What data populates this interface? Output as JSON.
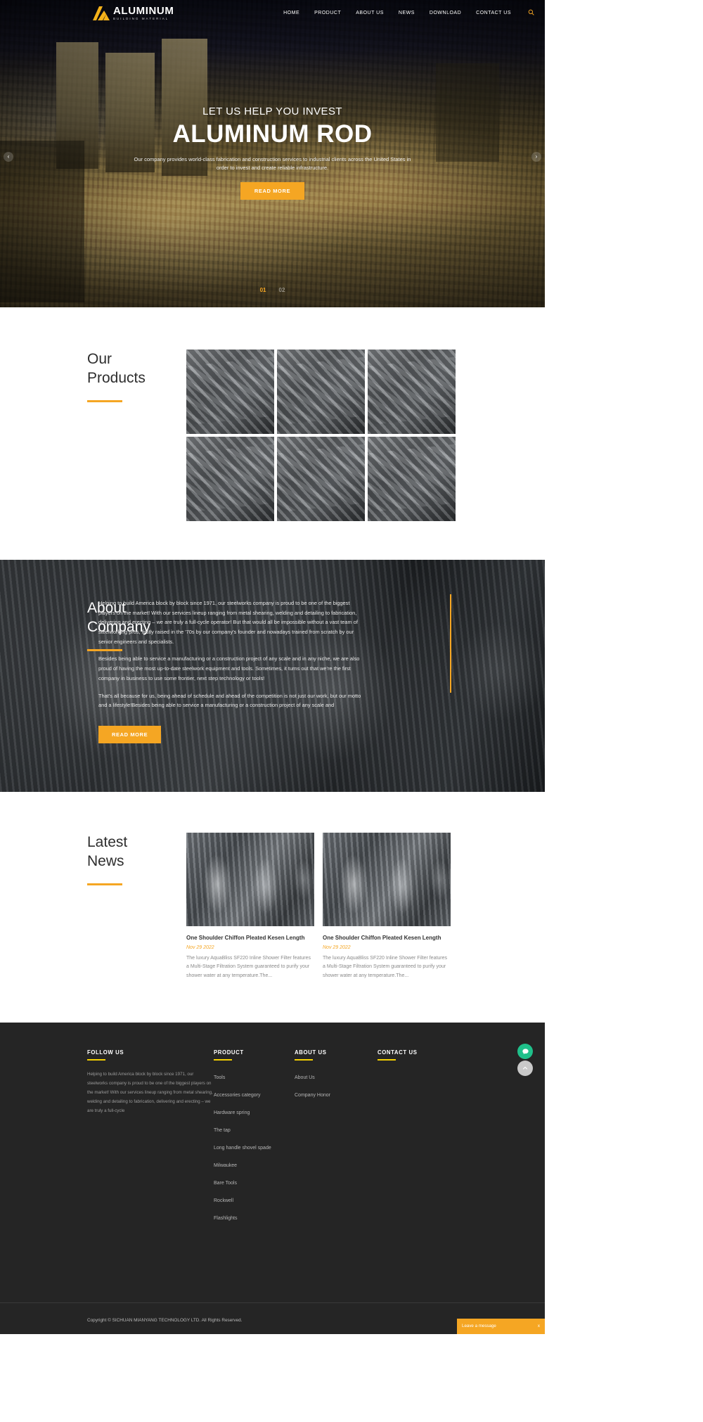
{
  "header": {
    "logo_text": "ALUMINUM",
    "logo_sub": "BUILDING MATERIAL",
    "nav": [
      {
        "label": "HOME"
      },
      {
        "label": "PRODUCT"
      },
      {
        "label": "ABOUT US"
      },
      {
        "label": "NEWS"
      },
      {
        "label": "DOWNLOAD"
      },
      {
        "label": "CONTACT US"
      }
    ],
    "search_icon": "search-icon"
  },
  "hero": {
    "kicker": "LET US HELP YOU INVEST",
    "title": "ALUMINUM ROD",
    "desc": "Our company provides world-class fabrication and construction services to industrial clients across the United States in order to invest and create reliable infrastructure.",
    "button": "READ MORE",
    "prev_icon": "chevron-left-icon",
    "next_icon": "chevron-right-icon",
    "slides": [
      {
        "label": "01",
        "active": true
      },
      {
        "label": "02",
        "active": false
      }
    ]
  },
  "products": {
    "title_line1": "Our",
    "title_line2": "Products",
    "items": [
      {
        "alt": "aluminum-profile-1"
      },
      {
        "alt": "aluminum-profile-2"
      },
      {
        "alt": "aluminum-profile-3"
      },
      {
        "alt": "aluminum-profile-4"
      },
      {
        "alt": "aluminum-profile-5"
      },
      {
        "alt": "aluminum-profile-6"
      }
    ]
  },
  "about": {
    "title_line1": "About",
    "title_line2": "Company",
    "p1": "Helping to build America block by block since 1971, our steelworks company is proud to be one of the biggest players on the market! With our services lineup ranging from metal shearing, welding and detailing to fabrication, delivering and erecting – we are truly a full-cycle operator! But that would all be impossible without a vast team of steelworking pros, firstly raised in the '70s by our company's founder and nowadays trained from scratch by our senior engineers and specialists.",
    "p2": "Besides being able to service a manufacturing or a construction project of any scale and in any niche, we are also proud of having the most up-to-date steelwork equipment and tools. Sometimes, it turns out that we're the first company in business to use some frontier, next step technology or tools!",
    "p3": "That's all because for us, being ahead of schedule and ahead of the competition is not just our work, but our motto and a lifestyle!Besides being able to service a manufacturing or a construction project of any scale and",
    "button": "READ MORE"
  },
  "news": {
    "title_line1": "Latest",
    "title_line2": "News",
    "cards": [
      {
        "title": "One Shoulder Chiffon Pleated Kesen Length",
        "date": "Nov 29 2022",
        "text": "The luxury AquaBliss SF220 Inline Shower Filter features a Multi-Stage Filtration System guaranteed to purify your shower water at any temperature.The..."
      },
      {
        "title": "One Shoulder Chiffon Pleated Kesen Length",
        "date": "Nov 29 2022",
        "text": "The luxury AquaBliss SF220 Inline Shower Filter features a Multi-Stage Filtration System guaranteed to purify your shower water at any temperature.The..."
      }
    ]
  },
  "footer": {
    "follow": {
      "title": "FOLLOW US",
      "text": "Helping to build America block by block since 1971, our steelworks company is proud to be one of the biggest players on the market! With our services lineup ranging from metal shearing, welding and detailing to fabrication, delivering and erecting – we are truly a full-cycle"
    },
    "product": {
      "title": "PRODUCT",
      "links": [
        {
          "label": "Tools"
        },
        {
          "label": "Accessories category"
        },
        {
          "label": "Hardware spring"
        },
        {
          "label": "The tap"
        },
        {
          "label": "Long handle shovel spade"
        },
        {
          "label": "Milwaukee"
        },
        {
          "label": "Bare Tools"
        },
        {
          "label": "Rockwell"
        },
        {
          "label": "Flashlights"
        }
      ]
    },
    "about": {
      "title": "ABOUT US",
      "links": [
        {
          "label": "About Us"
        },
        {
          "label": "Company Honor"
        }
      ]
    },
    "contact": {
      "title": "CONTACT US",
      "links": []
    },
    "copyright": "Copyright © SICHUAN MIANYANG TECHNOLOGY LTD. All Rights Reserved."
  },
  "widgets": {
    "chat_icon": "chat-bubble-icon",
    "scroll_top_icon": "chevron-up-icon",
    "leave_message": "Leave a message",
    "leave_message_close": "x"
  },
  "colors": {
    "accent": "#f5a623",
    "footer_bg": "#252525",
    "footer_rule": "#f5d000",
    "chat_green": "#1fc08a"
  }
}
